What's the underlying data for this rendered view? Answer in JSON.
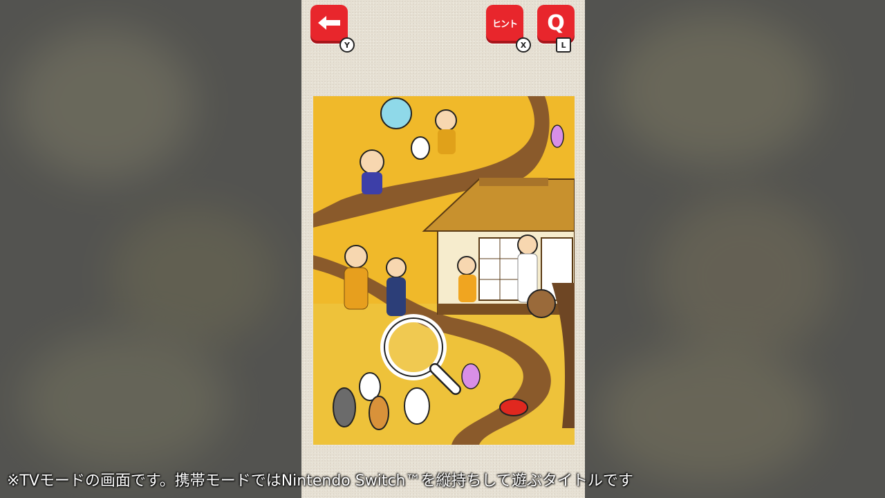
{
  "buttons": {
    "back": {
      "icon": "left-arrow-icon",
      "key": "Y"
    },
    "hint": {
      "label": "ヒント",
      "key": "X"
    },
    "question": {
      "label": "Q",
      "key": "L"
    }
  },
  "caption": "※TVモードの画面です。携帯モードではNintendo Switch™を縦持ちして遊ぶタイトルです",
  "colors": {
    "button_red": "#e8262c",
    "panel_bg": "#e6e0d3",
    "scene_yellow": "#f0b92a",
    "path_brown": "#8a5a2b"
  }
}
